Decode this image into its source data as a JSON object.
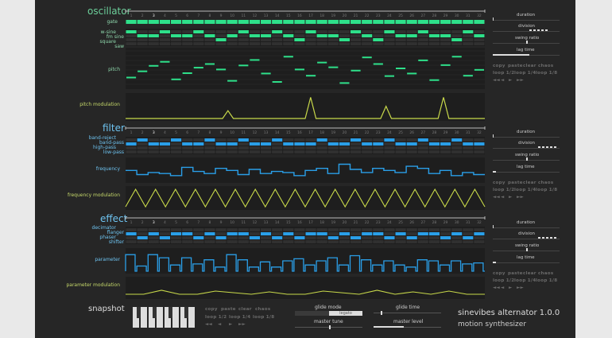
{
  "sections": {
    "oscillator": {
      "title": "oscillator",
      "gate_label": "gate",
      "wave_labels": [
        "w-sine",
        "fm sine",
        "square",
        "saw"
      ],
      "pitch_label": "pitch",
      "mod_label": "pitch modulation"
    },
    "filter": {
      "title": "filter",
      "type_labels": [
        "band-reject",
        "band-pass",
        "high-pass",
        "low-pass"
      ],
      "param_label": "frequency",
      "mod_label": "frequency modulation"
    },
    "effect": {
      "title": "effect",
      "type_labels": [
        "decimator",
        "flanger",
        "phaser",
        "shifter"
      ],
      "param_label": "parameter",
      "mod_label": "parameter modulation"
    }
  },
  "steps": [
    "1",
    "2",
    "3",
    "4",
    "5",
    "6",
    "7",
    "8",
    "9",
    "10",
    "11",
    "12",
    "13",
    "14",
    "15",
    "16",
    "17",
    "18",
    "19",
    "20",
    "21",
    "22",
    "23",
    "24",
    "25",
    "26",
    "27",
    "28",
    "29",
    "30",
    "31",
    "32"
  ],
  "current_step": 3,
  "side": {
    "duration": "duration",
    "division": "division",
    "swing": "swing ratio",
    "lag": "lag time",
    "row1": [
      "copy",
      "paste",
      "clear",
      "chaos"
    ],
    "row2": [
      "loop 1/2",
      "loop 1/4",
      "loop 1/8"
    ],
    "arrows": [
      "◄◄",
      "◄",
      "►",
      "►►"
    ]
  },
  "footer": {
    "snapshot": "snapshot",
    "glide_mode": "glide mode",
    "glide_opt_a": "",
    "glide_opt_b": "legato",
    "glide_time": "glide time",
    "master_tune": "master tune",
    "master_level": "master level",
    "title": "sinevibes alternator 1.0.0",
    "subtitle": "motion synthesizer"
  },
  "colors": {
    "green": "#2ee08a",
    "blue": "#2a9fe8",
    "yellow": "#c8d94a",
    "panel": "#262626"
  },
  "patterns": {
    "osc_wave_rows": [
      [
        1,
        0,
        0,
        1,
        0,
        0,
        1,
        0,
        0,
        0,
        1,
        0,
        0,
        1,
        0,
        0,
        1,
        0,
        0,
        0,
        1,
        0,
        0,
        1,
        0,
        0,
        1,
        0,
        0,
        0,
        1,
        0
      ],
      [
        0,
        1,
        1,
        0,
        1,
        1,
        0,
        1,
        0,
        1,
        0,
        1,
        1,
        0,
        1,
        0,
        0,
        1,
        1,
        0,
        0,
        1,
        0,
        0,
        1,
        1,
        0,
        1,
        1,
        0,
        0,
        1
      ],
      [
        0,
        0,
        0,
        0,
        0,
        0,
        0,
        0,
        1,
        0,
        0,
        0,
        0,
        0,
        0,
        1,
        0,
        0,
        0,
        1,
        0,
        0,
        1,
        0,
        0,
        0,
        0,
        0,
        0,
        1,
        0,
        0
      ],
      [
        0,
        0,
        0,
        0,
        0,
        0,
        0,
        0,
        0,
        0,
        0,
        0,
        0,
        0,
        0,
        0,
        0,
        0,
        0,
        0,
        0,
        0,
        0,
        0,
        0,
        0,
        0,
        0,
        0,
        0,
        0,
        0
      ]
    ],
    "pitch": [
      0.25,
      0.42,
      0.57,
      0.68,
      0.2,
      0.37,
      0.52,
      0.62,
      0.47,
      0.16,
      0.58,
      0.73,
      0.36,
      0.13,
      0.82,
      0.47,
      0.3,
      0.66,
      0.53,
      0.1,
      0.44,
      0.8,
      0.62,
      0.29,
      0.5,
      0.36,
      0.72,
      0.18,
      0.59,
      0.82,
      0.3,
      0.46
    ],
    "pitch_mod": [
      [
        0,
        0
      ],
      [
        0.27,
        0
      ],
      [
        0.285,
        0.35
      ],
      [
        0.3,
        0
      ],
      [
        0.5,
        0
      ],
      [
        0.515,
        0.95
      ],
      [
        0.53,
        0
      ],
      [
        0.71,
        0
      ],
      [
        0.725,
        0.55
      ],
      [
        0.74,
        0
      ],
      [
        0.87,
        0
      ],
      [
        0.885,
        0.95
      ],
      [
        0.9,
        0
      ],
      [
        1,
        0
      ]
    ],
    "filter_type_rows": [
      [
        0,
        1,
        0,
        0,
        1,
        0,
        0,
        1,
        0,
        0,
        1,
        0,
        0,
        1,
        0,
        0,
        0,
        1,
        0,
        0,
        1,
        0,
        0,
        1,
        0,
        0,
        1,
        0,
        0,
        1,
        0,
        0
      ],
      [
        1,
        0,
        1,
        1,
        0,
        1,
        1,
        0,
        1,
        1,
        0,
        1,
        1,
        0,
        1,
        1,
        1,
        0,
        1,
        1,
        0,
        1,
        1,
        0,
        1,
        1,
        0,
        1,
        1,
        0,
        1,
        1
      ],
      [
        0,
        0,
        0,
        0,
        0,
        0,
        0,
        0,
        0,
        0,
        0,
        0,
        0,
        0,
        0,
        0,
        0,
        0,
        0,
        0,
        0,
        0,
        0,
        0,
        0,
        0,
        0,
        0,
        0,
        0,
        0,
        0
      ],
      [
        0,
        0,
        0,
        0,
        0,
        0,
        0,
        0,
        0,
        0,
        0,
        0,
        0,
        0,
        0,
        0,
        0,
        0,
        0,
        0,
        0,
        0,
        0,
        0,
        0,
        0,
        0,
        0,
        0,
        0,
        0,
        0
      ]
    ],
    "frequency": [
      0.45,
      0.25,
      0.35,
      0.3,
      0.2,
      0.6,
      0.4,
      0.3,
      0.55,
      0.45,
      0.25,
      0.5,
      0.3,
      0.4,
      0.35,
      0.2,
      0.45,
      0.55,
      0.3,
      0.75,
      0.5,
      0.35,
      0.55,
      0.45,
      0.35,
      0.65,
      0.55,
      0.3,
      0.45,
      0.2,
      0.35,
      0.25
    ],
    "filter_mod_count": 18,
    "effect_type_rows": [
      [
        0,
        0,
        0,
        0,
        0,
        0,
        0,
        0,
        0,
        0,
        0,
        0,
        0,
        0,
        0,
        0,
        0,
        0,
        0,
        0,
        0,
        0,
        0,
        0,
        0,
        0,
        0,
        0,
        0,
        0,
        0,
        0
      ],
      [
        1,
        0,
        1,
        0,
        1,
        1,
        0,
        1,
        0,
        1,
        1,
        0,
        1,
        0,
        1,
        0,
        1,
        1,
        0,
        1,
        0,
        1,
        1,
        0,
        1,
        0,
        1,
        1,
        0,
        1,
        0,
        1
      ],
      [
        0,
        1,
        0,
        1,
        0,
        0,
        1,
        0,
        1,
        0,
        0,
        1,
        0,
        1,
        0,
        1,
        0,
        0,
        1,
        0,
        1,
        0,
        0,
        1,
        0,
        1,
        0,
        0,
        1,
        0,
        1,
        0
      ],
      [
        0,
        0,
        0,
        0,
        0,
        0,
        0,
        0,
        0,
        0,
        0,
        0,
        0,
        0,
        0,
        0,
        0,
        0,
        0,
        0,
        0,
        0,
        0,
        0,
        0,
        0,
        0,
        0,
        0,
        0,
        0,
        0
      ]
    ],
    "parameter": [
      0.8,
      0.25,
      0.8,
      0.65,
      0.3,
      0.65,
      0.35,
      0.55,
      0.2,
      0.8,
      0.55,
      0.2,
      0.45,
      0.2,
      0.5,
      0.6,
      0.3,
      0.5,
      0.65,
      0.3,
      0.75,
      0.55,
      0.3,
      0.5,
      0.3,
      0.2,
      0.55,
      0.5,
      0.3,
      0.5,
      0.35,
      0.4
    ],
    "param_mod": [
      [
        0,
        0.1
      ],
      [
        0.05,
        0.1
      ],
      [
        0.1,
        0.35
      ],
      [
        0.15,
        0.1
      ],
      [
        0.2,
        0.1
      ],
      [
        0.25,
        0.3
      ],
      [
        0.3,
        0.2
      ],
      [
        0.35,
        0.1
      ],
      [
        0.4,
        0.25
      ],
      [
        0.45,
        0.1
      ],
      [
        0.5,
        0.1
      ],
      [
        0.55,
        0.3
      ],
      [
        0.6,
        0.2
      ],
      [
        0.65,
        0.1
      ],
      [
        0.7,
        0.35
      ],
      [
        0.75,
        0.1
      ],
      [
        0.8,
        0.25
      ],
      [
        0.85,
        0.1
      ],
      [
        0.9,
        0.3
      ],
      [
        0.95,
        0.1
      ],
      [
        1,
        0.1
      ]
    ],
    "snapshot_keys": [
      1,
      1,
      1,
      0,
      1,
      1,
      0,
      1
    ],
    "master_tune": 0.5,
    "master_level": 0.45,
    "glide_time": 0.1,
    "duration_values": [
      0,
      0,
      0
    ],
    "division_values": [
      0.55,
      0.68,
      0.68
    ],
    "swing_values": [
      0.5,
      0.5,
      0.5
    ],
    "lag_values": [
      0.55,
      0.05,
      0.05
    ]
  }
}
